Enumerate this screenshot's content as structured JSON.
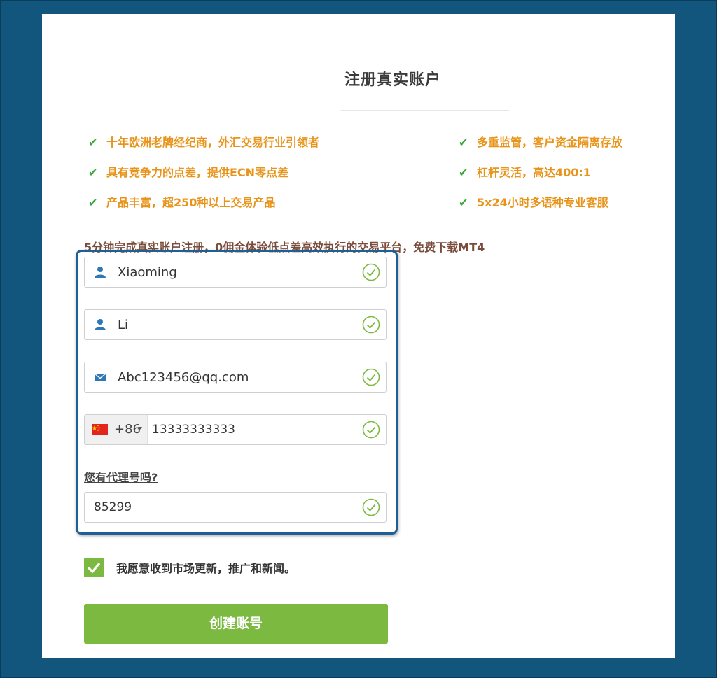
{
  "colors": {
    "page_background": "#12567e",
    "card_background": "#ffffff",
    "feature_text": "#e8941a",
    "check_green": "#3aa63a",
    "valid_green": "#7bb940",
    "highlight_border": "#1e5f96",
    "button_green": "#7bb940"
  },
  "form": {
    "title": "注册真实账户",
    "features": [
      "十年欧洲老牌经纪商，外汇交易行业引领者",
      "多重监管，客户资金隔离存放",
      "具有竞争力的点差，提供ECN零点差",
      "杠杆灵活，高达400:1",
      "产品丰富，超250种以上交易产品",
      "5x24小时多语种专业客服"
    ],
    "intro": "5分钟完成真实账户注册，0佣金体验低点差高效执行的交易平台，免费下载MT4",
    "first_name": {
      "value": "Xiaoming",
      "icon": "user-icon"
    },
    "last_name": {
      "value": "Li",
      "icon": "user-icon"
    },
    "email": {
      "value": "Abc123456@qq.com",
      "icon": "envelope-icon"
    },
    "phone": {
      "country_flag": "china-flag-icon",
      "prefix": "+86",
      "value": "13333333333"
    },
    "agent_link": "您有代理号吗?",
    "agent_code": {
      "value": "85299"
    },
    "consent_label": "我愿意收到市场更新，推广和新闻。",
    "consent_checked": true,
    "submit_label": "创建账号"
  }
}
